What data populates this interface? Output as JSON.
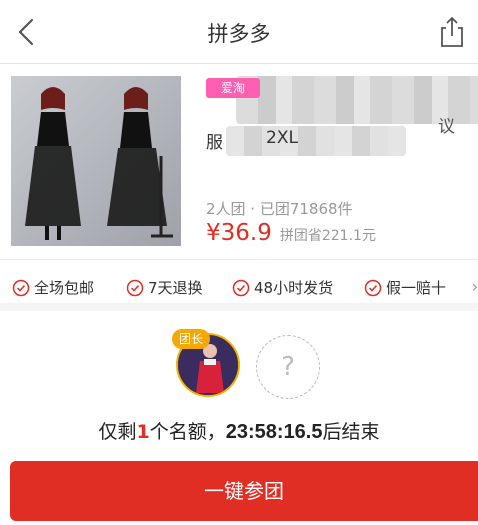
{
  "header": {
    "title": "拼多多",
    "back_icon": "chevron-left-icon",
    "share_icon": "share-icon"
  },
  "product": {
    "tag": "爱淘",
    "title_fragment_left": "服",
    "title_fragment_mid": "2XL",
    "title_fragment_right": "议",
    "group_info": "2人团 · 已团71868件",
    "price": "¥36.9",
    "saved": "拼团省221.1元"
  },
  "guarantees": {
    "items": [
      {
        "label": "全场包邮",
        "icon": "check-circle-icon"
      },
      {
        "label": "7天退换",
        "icon": "check-circle-icon"
      },
      {
        "label": "48小时发货",
        "icon": "check-circle-icon"
      },
      {
        "label": "假一赔十",
        "icon": "check-circle-icon"
      }
    ],
    "more": "›"
  },
  "team": {
    "leader_badge": "团长",
    "empty_slot": "?",
    "remain_prefix": "仅剩",
    "remain_count": "1",
    "remain_mid": "个名额，",
    "countdown": "23:58:16.5",
    "remain_suffix": "后结束"
  },
  "actions": {
    "join_label": "一键参团"
  },
  "colors": {
    "accent": "#e02e24",
    "tag": "#ff5fb0",
    "leader": "#f5a800"
  }
}
